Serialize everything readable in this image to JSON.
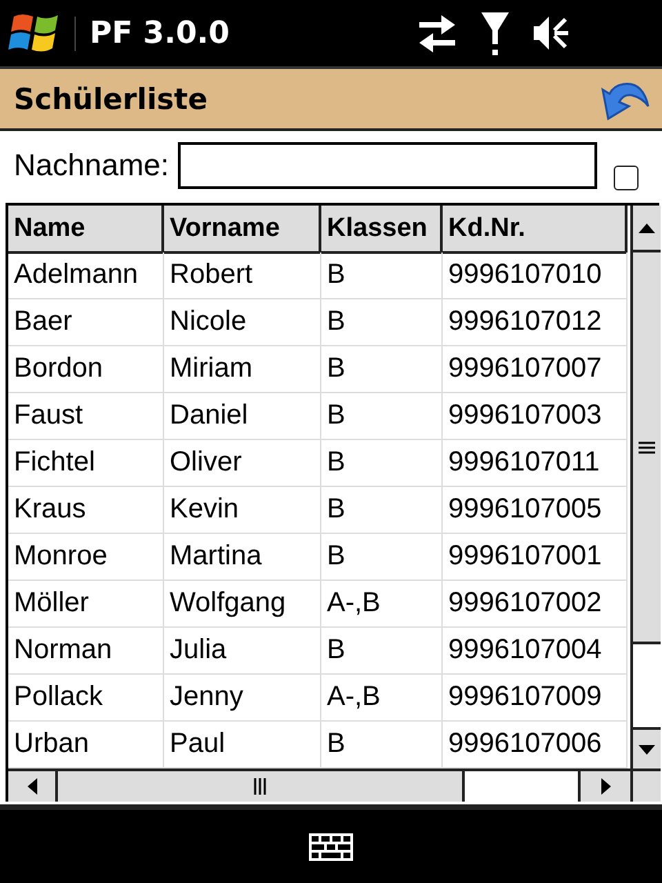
{
  "status_bar": {
    "title": "PF 3.0.0"
  },
  "title_bar": {
    "title": "Schülerliste"
  },
  "filter": {
    "label": "Nachname:",
    "checkbox": {
      "checked": false
    }
  },
  "table": {
    "columns": [
      "Name",
      "Vorname",
      "Klassen",
      "Kd.Nr."
    ],
    "rows": [
      [
        "Adelmann",
        "Robert",
        "B",
        "9996107010"
      ],
      [
        "Baer",
        "Nicole",
        "B",
        "9996107012"
      ],
      [
        "Bordon",
        "Miriam",
        "B",
        "9996107007"
      ],
      [
        "Faust",
        "Daniel",
        "B",
        "9996107003"
      ],
      [
        "Fichtel",
        "Oliver",
        "B",
        "9996107011"
      ],
      [
        "Kraus",
        "Kevin",
        "B",
        "9996107005"
      ],
      [
        "Monroe",
        "Martina",
        "B",
        "9996107001"
      ],
      [
        "Möller",
        "Wolfgang",
        "A-,B",
        "9996107002"
      ],
      [
        "Norman",
        "Julia",
        "B",
        "9996107004"
      ],
      [
        "Pollack",
        "Jenny",
        "A-,B",
        "9996107009"
      ],
      [
        "Urban",
        "Paul",
        "B",
        "9996107006"
      ]
    ]
  }
}
